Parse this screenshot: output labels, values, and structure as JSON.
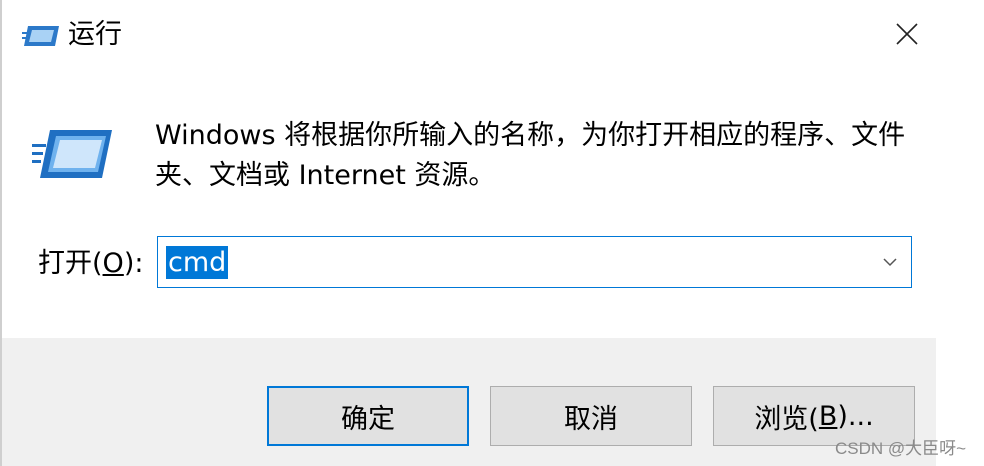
{
  "window": {
    "title": "运行",
    "title_icon": "run-icon",
    "close_icon": "close-icon"
  },
  "main": {
    "icon": "run-large-icon",
    "description": "Windows 将根据你所输入的名称，为你打开相应的程序、文件夹、文档或 Internet 资源。"
  },
  "open": {
    "label_prefix": "打开(",
    "label_key": "O",
    "label_suffix": "):",
    "value": "cmd",
    "dropdown_icon": "chevron-down-icon"
  },
  "buttons": {
    "ok": "确定",
    "cancel": "取消",
    "browse_prefix": "浏览(",
    "browse_key": "B",
    "browse_suffix": ")..."
  },
  "watermark": "CSDN @大臣呀~",
  "colors": {
    "accent": "#0078d7",
    "footer_bg": "#f0f0f0",
    "button_bg": "#e1e1e1"
  }
}
